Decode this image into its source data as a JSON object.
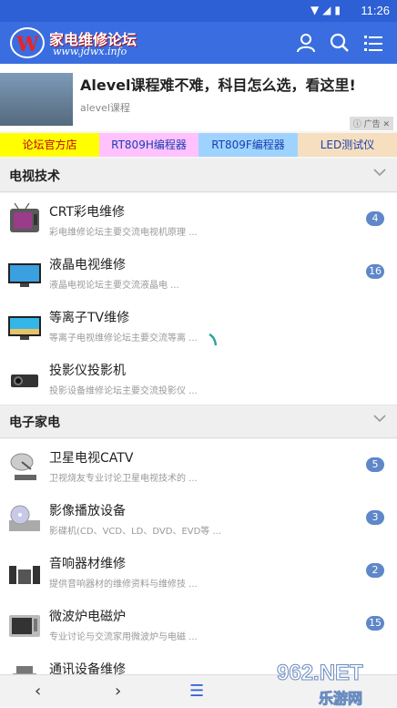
{
  "status": {
    "time": "11:26"
  },
  "header": {
    "logo_text": "家电维修论坛",
    "logo_url": "www.jdwx.info",
    "user_icon": "user-icon",
    "search_icon": "search-icon",
    "menu_icon": "menu-icon"
  },
  "ad": {
    "title": "Alevel课程难不难，科目怎么选，看这里!",
    "subtitle": "alevel课程",
    "badge": "广告"
  },
  "links": [
    {
      "label": "论坛官方店",
      "bg": "#ffff00",
      "color": "#c00000"
    },
    {
      "label": "RT809H编程器",
      "bg": "#ffc2ff",
      "color": "#1a3fb0"
    },
    {
      "label": "RT809F编程器",
      "bg": "#9fd3ff",
      "color": "#1a3fb0"
    },
    {
      "label": "LED测试仪",
      "bg": "#f6dfbf",
      "color": "#1a3fb0"
    }
  ],
  "sections": [
    {
      "label": "电视技术"
    },
    {
      "label": "电子家电"
    }
  ],
  "rows": [
    {
      "name": "CRT彩电维修",
      "desc": "彩电维修论坛主要交流电视机原理 ...",
      "count": "4",
      "icon": "crt-tv-icon"
    },
    {
      "name": "液晶电视维修",
      "desc": "液晶电视论坛主要交流液晶电 ...",
      "count": "16",
      "icon": "lcd-tv-icon"
    },
    {
      "name": "等离子TV维修",
      "desc": "等离子电视维修论坛主要交流等离 ...",
      "count": "",
      "icon": "plasma-tv-icon"
    },
    {
      "name": "投影仪投影机",
      "desc": "投影设备维修论坛主要交流投影仪 ...",
      "count": "",
      "icon": "projector-icon"
    },
    {
      "name": "卫星电视CATV",
      "desc": "卫视烧友专业讨论卫星电视技术的 ...",
      "count": "5",
      "icon": "satellite-dish-icon"
    },
    {
      "name": "影像播放设备",
      "desc": "影碟机(CD、VCD、LD、DVD、EVD等 ...",
      "count": "3",
      "icon": "dvd-player-icon"
    },
    {
      "name": "音响器材维修",
      "desc": "提供音响器材的维修资料与维修技 ...",
      "count": "2",
      "icon": "audio-system-icon"
    },
    {
      "name": "微波炉电磁炉",
      "desc": "专业讨论与交流家用微波炉与电磁 ...",
      "count": "15",
      "icon": "microwave-icon"
    },
    {
      "name": "通讯设备维修",
      "desc": "",
      "count": "",
      "icon": "phone-icon"
    }
  ],
  "bottom": {
    "back": "‹",
    "forward": "›",
    "menu": "☰"
  },
  "watermark": {
    "text": "962.NET",
    "sub": "乐游网"
  }
}
